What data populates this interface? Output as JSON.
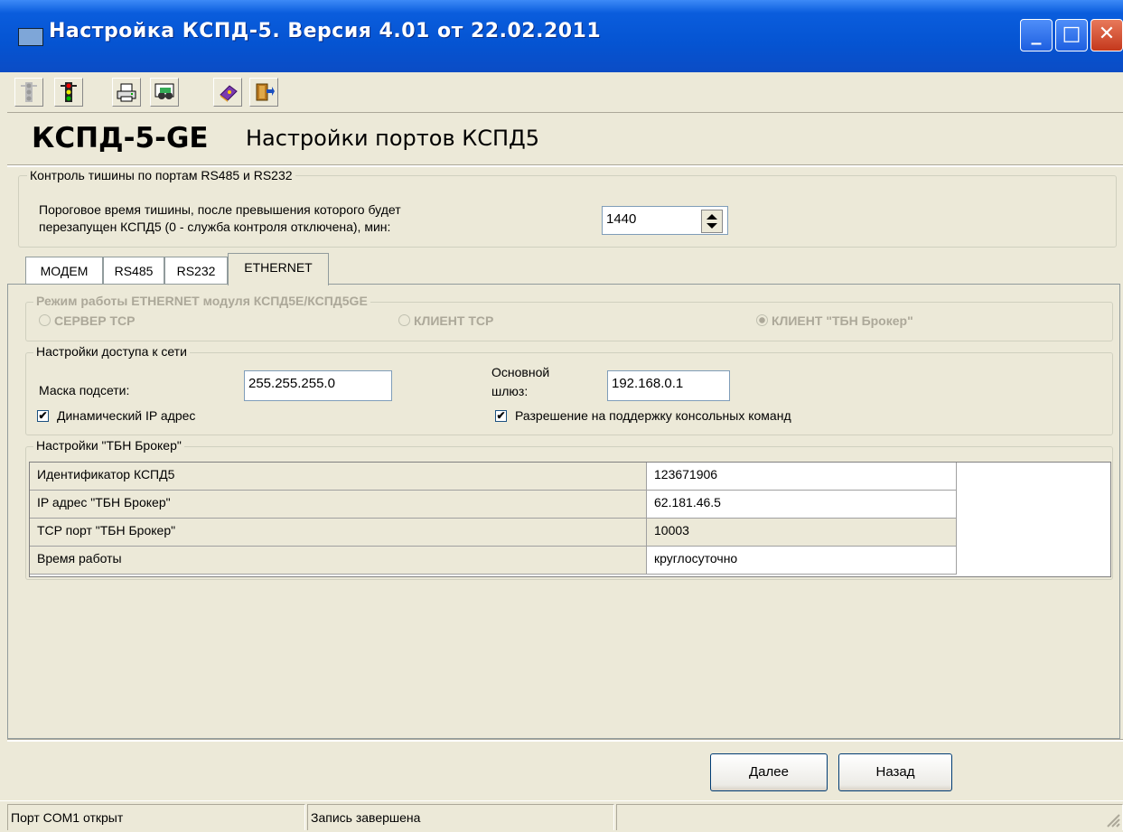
{
  "window": {
    "title": "Настройка КСПД-5. Версия 4.01 от 22.02.2011",
    "minimize_glyph": "_",
    "maximize_glyph": "□",
    "close_glyph": "✕"
  },
  "toolbar": {
    "icons": [
      "traffic-light-off-icon",
      "traffic-light-on-icon",
      "printer-icon",
      "binoculars-icon",
      "book-icon",
      "exit-door-icon"
    ]
  },
  "header": {
    "device": "КСПД-5-GE",
    "page": "Настройки портов КСПД5"
  },
  "silence": {
    "group_label": "Контроль тишины по портам RS485 и RS232",
    "desc_line1": "Пороговое время тишины, после превышения которого будет",
    "desc_line2": "перезапущен КСПД5 (0 - служба контроля отключена), мин:",
    "value": "1440"
  },
  "tabs": [
    {
      "label": "МОДЕМ"
    },
    {
      "label": "RS485"
    },
    {
      "label": "RS232"
    },
    {
      "label": "ETHERNET",
      "active": true
    }
  ],
  "mode": {
    "group_label": "Режим работы ETHERNET модуля КСПД5E/КСПД5GE",
    "options": [
      "СЕРВЕР TCP",
      "КЛИЕНТ TCP",
      "КЛИЕНТ \"ТБН Брокер\""
    ],
    "selected": "КЛИЕНТ \"ТБН Брокер\""
  },
  "network": {
    "group_label": "Настройки доступа к сети",
    "mask_label": "Маска подсети:",
    "mask_value": "255.255.255.0",
    "gateway_label_1": "Основной",
    "gateway_label_2": "шлюз:",
    "gateway_value": "192.168.0.1",
    "dynamic_ip_label": "Динамический IP адрес",
    "dynamic_ip_checked": true,
    "console_label": "Разрешение на поддержку консольных команд",
    "console_checked": true
  },
  "broker": {
    "group_label": "Настройки \"ТБН Брокер\"",
    "rows": [
      {
        "label": "Идентификатор КСПД5",
        "value": "123671906"
      },
      {
        "label": "IP адрес \"ТБН Брокер\"",
        "value": "62.181.46.5"
      },
      {
        "label": "TCP порт \"ТБН Брокер\"",
        "value": "10003"
      },
      {
        "label": "Время работы",
        "value": "круглосуточно"
      }
    ]
  },
  "buttons": {
    "next": "Далее",
    "back": "Назад"
  },
  "status": {
    "port": "Порт COM1 открыт",
    "write": "Запись завершена",
    "extra": ""
  },
  "colors": {
    "titlebar": "#0554d2",
    "face": "#ece9d8",
    "disabled_text": "#aca899"
  }
}
